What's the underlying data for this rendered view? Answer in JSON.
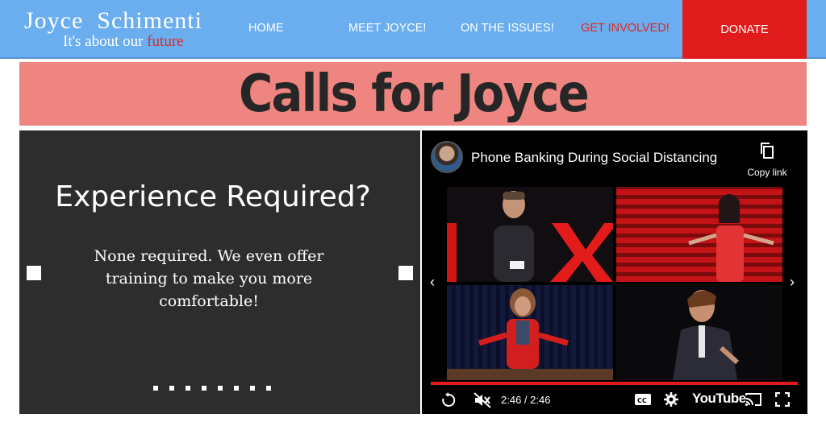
{
  "header": {
    "logo_name": "Joyce  Schimenti",
    "logo_tag_prefix": "It's about our ",
    "logo_tag_accent": "future",
    "nav": [
      {
        "label": "HOME"
      },
      {
        "label": "MEET JOYCE!"
      },
      {
        "label": "ON THE ISSUES!"
      },
      {
        "label": "GET INVOLVED!"
      }
    ],
    "donate_label": "DONATE"
  },
  "banner": {
    "title": "Calls for Joyce"
  },
  "slider": {
    "title": "Experience Required?",
    "body": "None required. We even offer training to make you more comfortable!",
    "dot_count": 8
  },
  "video": {
    "title": "Phone Banking During Social Distancing",
    "copy_label": "Copy link",
    "time": "2:46 / 2:46",
    "brand": "YouTube"
  },
  "colors": {
    "header_bg": "#6aaef0",
    "accent_red": "#e0271f",
    "donate_bg": "#e01b1b",
    "banner_bg": "#ee8580",
    "slider_bg": "#2d2d2d"
  }
}
